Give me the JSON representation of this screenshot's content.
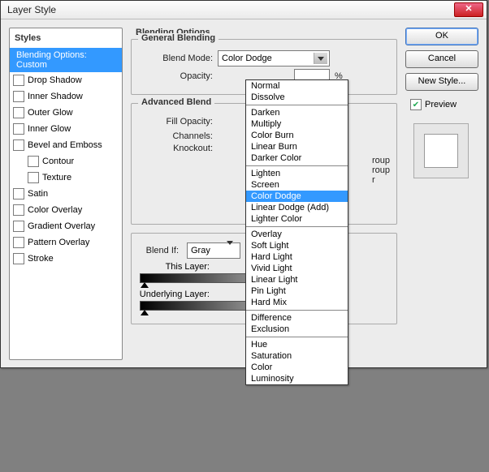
{
  "title": "Layer Style",
  "sidebar": {
    "header": "Styles",
    "items": [
      {
        "label": "Blending Options: Custom",
        "selected": true,
        "noChk": true
      },
      {
        "label": "Drop Shadow"
      },
      {
        "label": "Inner Shadow"
      },
      {
        "label": "Outer Glow"
      },
      {
        "label": "Inner Glow"
      },
      {
        "label": "Bevel and Emboss"
      },
      {
        "label": "Contour",
        "indent": true
      },
      {
        "label": "Texture",
        "indent": true
      },
      {
        "label": "Satin"
      },
      {
        "label": "Color Overlay"
      },
      {
        "label": "Gradient Overlay"
      },
      {
        "label": "Pattern Overlay"
      },
      {
        "label": "Stroke"
      }
    ]
  },
  "main": {
    "heading": "Blending Options",
    "general": {
      "legend": "General Blending",
      "blendModeLabel": "Blend Mode:",
      "blendModeValue": "Color Dodge",
      "opacityLabel": "Opacity:",
      "opacityValue": "",
      "opacityUnit": "%"
    },
    "advanced": {
      "legend": "Advanced Blend",
      "fillOpacityLabel": "Fill Opacity:",
      "fillUnit": "%",
      "channelsLabel": "Channels:",
      "knockoutLabel": "Knockout:",
      "extra": [
        "roup",
        "roup",
        "r"
      ]
    },
    "blendif": {
      "label": "Blend If:",
      "value": "Gray",
      "thisLayerLabel": "This Layer:",
      "underLabel": "Underlying Layer:"
    }
  },
  "buttons": {
    "ok": "OK",
    "cancel": "Cancel",
    "newStyle": "New Style...",
    "preview": "Preview"
  },
  "dropdown": {
    "groups": [
      [
        "Normal",
        "Dissolve"
      ],
      [
        "Darken",
        "Multiply",
        "Color Burn",
        "Linear Burn",
        "Darker Color"
      ],
      [
        "Lighten",
        "Screen",
        "Color Dodge",
        "Linear Dodge (Add)",
        "Lighter Color"
      ],
      [
        "Overlay",
        "Soft Light",
        "Hard Light",
        "Vivid Light",
        "Linear Light",
        "Pin Light",
        "Hard Mix"
      ],
      [
        "Difference",
        "Exclusion"
      ],
      [
        "Hue",
        "Saturation",
        "Color",
        "Luminosity"
      ]
    ],
    "highlighted": "Color Dodge"
  }
}
